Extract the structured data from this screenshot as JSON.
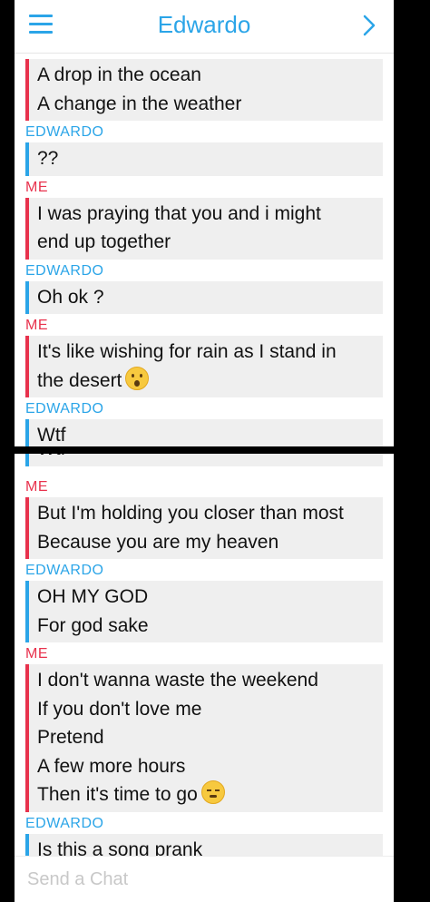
{
  "header": {
    "title": "Edwardo",
    "menu_icon": "hamburger-menu-icon",
    "next_icon": "chevron-right-icon"
  },
  "colors": {
    "accent_blue": "#2ba5e8",
    "accent_red": "#e8324d",
    "bubble_bg": "#efefef"
  },
  "screen1": {
    "messages": [
      {
        "sender": "",
        "who": "me",
        "lines": [
          "A drop in the ocean",
          "A change in the weather"
        ]
      },
      {
        "sender": "EDWARDO",
        "who": "them",
        "lines": [
          "??"
        ]
      },
      {
        "sender": "ME",
        "who": "me",
        "lines": [
          "I was praying that you and i might",
          "end up together"
        ]
      },
      {
        "sender": "EDWARDO",
        "who": "them",
        "lines": [
          "Oh ok ?"
        ]
      },
      {
        "sender": "ME",
        "who": "me",
        "lines": [
          "It's like wishing for rain as I stand in",
          "the desert"
        ]
      },
      {
        "sender": "EDWARDO",
        "who": "them",
        "lines": [
          "Wtf"
        ]
      }
    ]
  },
  "screen2": {
    "cut_text": "Wtf",
    "messages": [
      {
        "sender": "ME",
        "who": "me",
        "lines": [
          "But I'm holding you closer than most",
          "Because you are my heaven"
        ]
      },
      {
        "sender": "EDWARDO",
        "who": "them",
        "lines": [
          "OH MY GOD",
          "For god sake"
        ]
      },
      {
        "sender": "ME",
        "who": "me",
        "lines": [
          "I don't wanna waste the weekend",
          "If you don't love me",
          "Pretend",
          "A few more hours",
          "Then it's time to go"
        ]
      },
      {
        "sender": "EDWARDO",
        "who": "them",
        "lines": [
          "Is this a song prank"
        ]
      }
    ],
    "input_placeholder": "Send a Chat"
  }
}
